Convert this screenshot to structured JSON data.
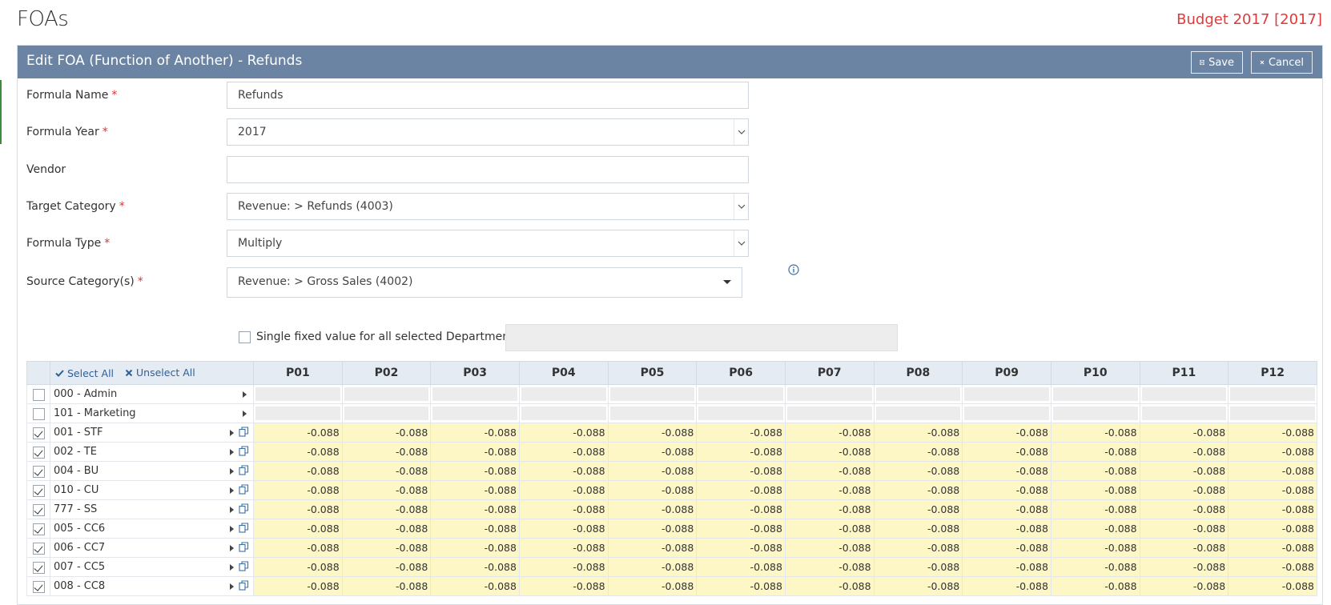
{
  "page": {
    "title": "FOAs",
    "budget": "Budget 2017 [2017]"
  },
  "panel": {
    "title": "Edit FOA (Function of Another) - Refunds",
    "save_label": "Save",
    "cancel_label": "Cancel"
  },
  "form": {
    "formula_name": {
      "label": "Formula Name",
      "required": "*",
      "value": "Refunds"
    },
    "formula_year": {
      "label": "Formula Year",
      "required": "*",
      "value": "2017"
    },
    "vendor": {
      "label": "Vendor",
      "value": ""
    },
    "target_category": {
      "label": "Target Category",
      "required": "*",
      "value": "Revenue: > Refunds (4003)"
    },
    "formula_type": {
      "label": "Formula Type",
      "required": "*",
      "value": "Multiply"
    },
    "source_categories": {
      "label": "Source Category(s)",
      "required": "*",
      "value": "Revenue: > Gross Sales (4002)"
    },
    "single_fixed": {
      "label": "Single fixed value for all selected Department",
      "checked": false,
      "value": ""
    }
  },
  "grid": {
    "select_all_label": "Select All",
    "unselect_all_label": "Unselect All",
    "periods": [
      "P01",
      "P02",
      "P03",
      "P04",
      "P05",
      "P06",
      "P07",
      "P08",
      "P09",
      "P10",
      "P11",
      "P12"
    ],
    "rows": [
      {
        "name": "000 - Admin",
        "checked": false,
        "value": ""
      },
      {
        "name": "101 - Marketing",
        "checked": false,
        "value": ""
      },
      {
        "name": "001 - STF",
        "checked": true,
        "value": "-0.088"
      },
      {
        "name": "002 - TE",
        "checked": true,
        "value": "-0.088"
      },
      {
        "name": "004 - BU",
        "checked": true,
        "value": "-0.088"
      },
      {
        "name": "010 - CU",
        "checked": true,
        "value": "-0.088"
      },
      {
        "name": "777 - SS",
        "checked": true,
        "value": "-0.088"
      },
      {
        "name": "005 - CC6",
        "checked": true,
        "value": "-0.088"
      },
      {
        "name": "006 - CC7",
        "checked": true,
        "value": "-0.088"
      },
      {
        "name": "007 - CC5",
        "checked": true,
        "value": "-0.088"
      },
      {
        "name": "008 - CC8",
        "checked": true,
        "value": "-0.088"
      }
    ]
  },
  "colors": {
    "header_bg": "#6b84a3",
    "budget_red": "#e03a3a",
    "value_cell_bg": "#fdf7c6",
    "grid_header_bg": "#e4ebf3"
  },
  "icons": {
    "save": "floppy-disk-icon",
    "cancel": "x-icon",
    "info": "info-circle-icon",
    "copy": "copy-icon",
    "expand": "caret-right-icon"
  }
}
